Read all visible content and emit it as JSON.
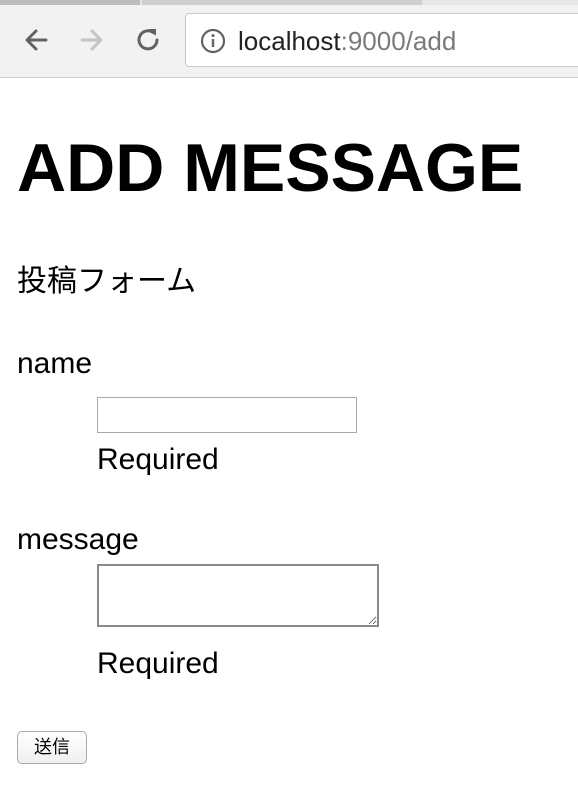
{
  "browser": {
    "url_host": "localhost",
    "url_path": ":9000/add",
    "icons": {
      "back": "back-arrow-icon",
      "forward": "forward-arrow-icon",
      "reload": "reload-icon",
      "info": "info-icon"
    }
  },
  "page": {
    "title": "ADD MESSAGE",
    "form_title": "投稿フォーム",
    "fields": {
      "name": {
        "label": "name",
        "value": "",
        "hint": "Required"
      },
      "message": {
        "label": "message",
        "value": "",
        "hint": "Required"
      }
    },
    "submit_label": "送信"
  }
}
